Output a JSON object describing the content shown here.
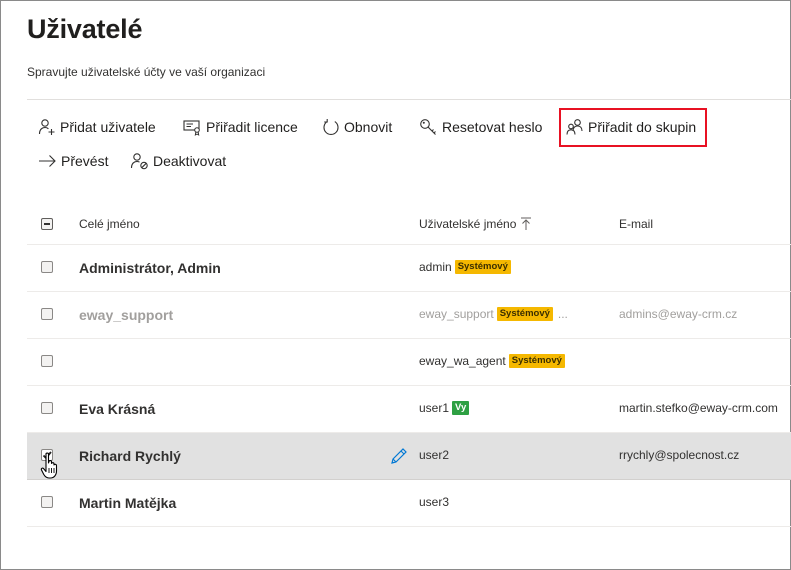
{
  "page": {
    "title": "Uživatelé",
    "subtitle": "Spravujte uživatelské účty ve vaší organizaci"
  },
  "commands": [
    {
      "label": "Přidat uživatele",
      "icon": "add-user-icon"
    },
    {
      "label": "Přiřadit licence",
      "icon": "assign-license-icon"
    },
    {
      "label": "Obnovit",
      "icon": "refresh-icon"
    },
    {
      "label": "Resetovat heslo",
      "icon": "key-icon"
    },
    {
      "label": "Přiřadit do skupin",
      "icon": "group-icon",
      "highlighted": true
    },
    {
      "label": "Převést",
      "icon": "arrow-right-icon"
    },
    {
      "label": "Deaktivovat",
      "icon": "deactivate-user-icon"
    }
  ],
  "table": {
    "columns": {
      "name": "Celé jméno",
      "username": "Uživatelské jméno",
      "email": "E-mail"
    },
    "sort": {
      "column": "username",
      "direction": "ascending"
    },
    "rows": [
      {
        "name": "Administrátor, Admin",
        "username": "admin",
        "badge": "Systémový",
        "email": "",
        "muted": false,
        "selected": false
      },
      {
        "name": "eway_support",
        "username": "eway_support",
        "badge": "Systémový",
        "more": "...",
        "email": "admins@eway-crm.cz",
        "muted": true,
        "selected": false
      },
      {
        "name": "",
        "username": "eway_wa_agent",
        "badge": "Systémový",
        "email": "",
        "muted": false,
        "selected": false
      },
      {
        "name": "Eva Krásná",
        "username": "user1",
        "badge": "Vy",
        "email": "martin.stefko@eway-crm.com",
        "muted": false,
        "selected": false
      },
      {
        "name": "Richard Rychlý",
        "username": "user2",
        "badge": "",
        "email": "rrychly@spolecnost.cz",
        "muted": false,
        "selected": true
      },
      {
        "name": "Martin Matějka",
        "username": "user3",
        "badge": "",
        "email": "",
        "muted": false,
        "selected": false
      }
    ]
  },
  "colors": {
    "highlight_border": "#e81123",
    "system_badge": "#f5b800",
    "you_badge": "#2ea043",
    "selected_row": "#e1e1e1",
    "edit_icon": "#0078d4"
  }
}
